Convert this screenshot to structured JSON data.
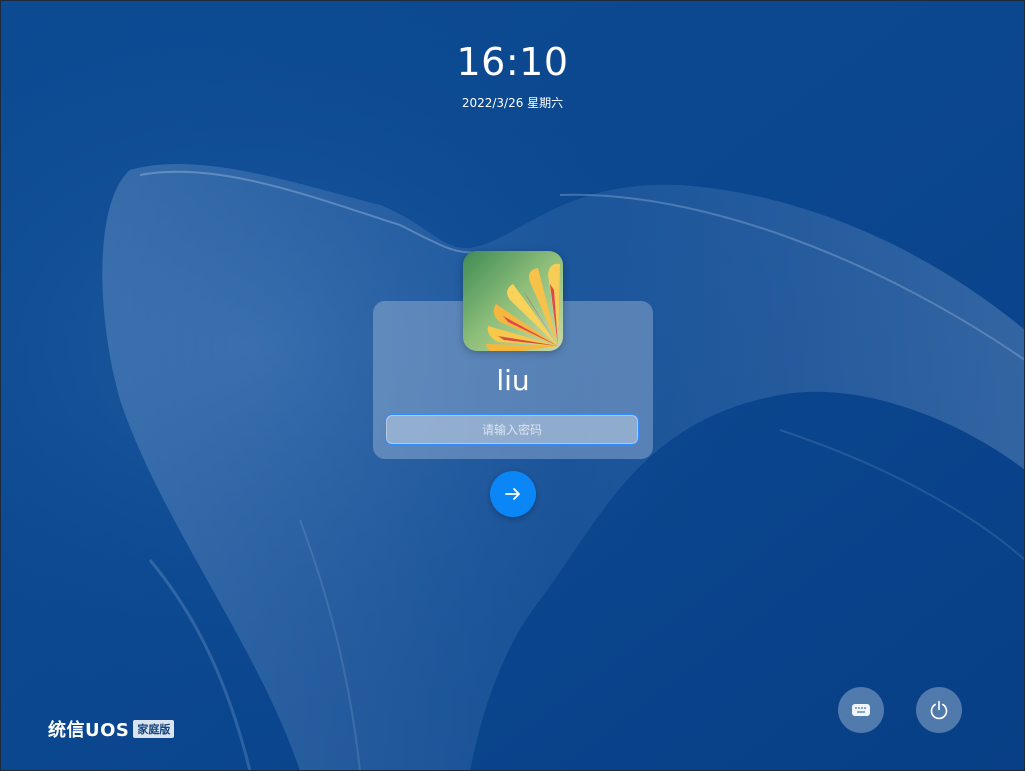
{
  "lock_screen": {
    "time": "16:10",
    "date": "2022/3/26 星期六"
  },
  "user": {
    "name": "liu",
    "avatar_icon": "flower-avatar"
  },
  "password": {
    "placeholder": "请输入密码",
    "value": ""
  },
  "buttons": {
    "submit_icon": "arrow-right-icon",
    "keyboard_icon": "keyboard-icon",
    "power_icon": "power-icon"
  },
  "branding": {
    "name": "统信UOS",
    "edition": "家庭版"
  },
  "colors": {
    "background": "#0a4690",
    "accent": "#0a86f7",
    "field_border": "#2f8cff"
  }
}
